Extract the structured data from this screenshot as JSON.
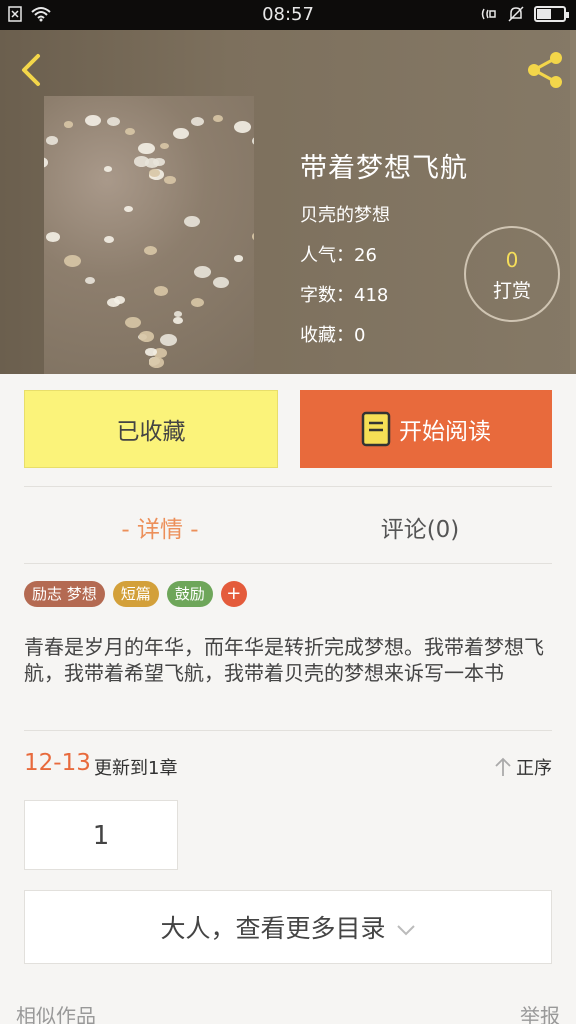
{
  "status_bar": {
    "time": "08:57",
    "battery_level": 0.55,
    "icons": [
      "sim-icon",
      "wifi-icon",
      "nfc-icon",
      "bell-muted-icon",
      "battery-icon"
    ]
  },
  "book": {
    "title": "带着梦想飞航",
    "author": "贝壳的梦想",
    "popularity": "人气：26",
    "word_count": "字数：418",
    "favorites": "收藏：0"
  },
  "tip": {
    "count": "0",
    "label": "打赏"
  },
  "actions": {
    "favorite_label": "已收藏",
    "read_label": "开始阅读"
  },
  "tabs": {
    "detail": "- 详情 -",
    "comments": "评论(0)"
  },
  "tags": [
    {
      "label": "励志 梦想",
      "color": "#b46a52"
    },
    {
      "label": "短篇",
      "color": "#d3a03a"
    },
    {
      "label": "鼓励",
      "color": "#6ea65a"
    }
  ],
  "tag_add": "+",
  "description": "青春是岁月的年华，而年华是转折完成梦想。我带着梦想飞航，我带着希望飞航，我带着贝壳的梦想来诉写一本书",
  "update": {
    "date": "12-13",
    "text": "更新到1章",
    "sort_label": "正序"
  },
  "chapters": [
    "1"
  ],
  "more_catalog": "大人，查看更多目录",
  "footer": {
    "similar": "相似作品",
    "report": "举报"
  },
  "colors": {
    "accent": "#e86a3c",
    "favorite_bg": "#fbf37a",
    "tab_active": "#ec8f59"
  }
}
